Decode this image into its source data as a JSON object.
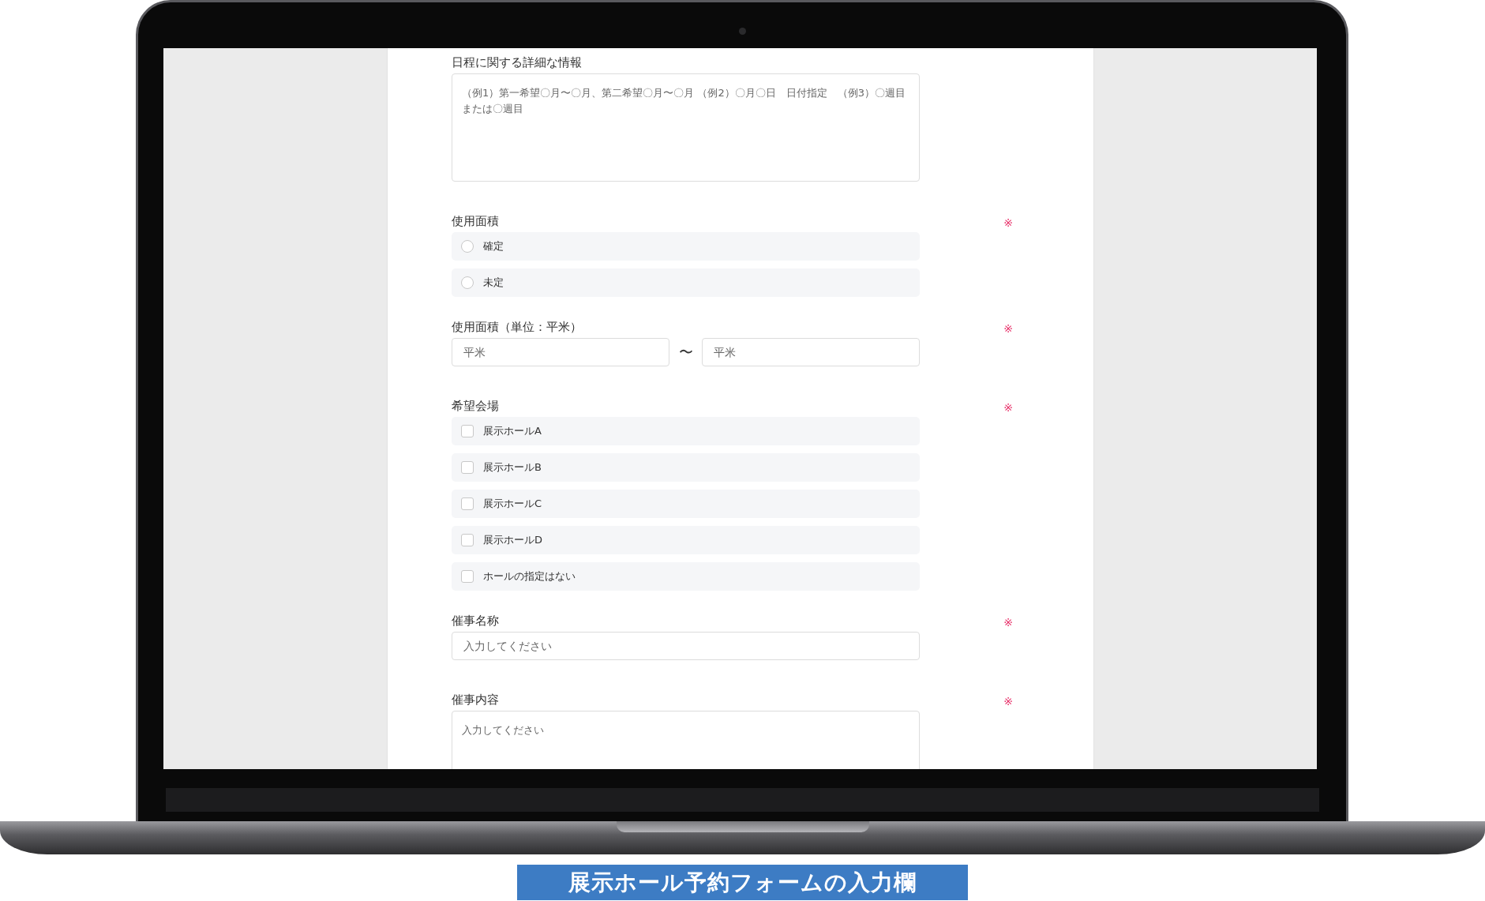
{
  "form": {
    "sections": [
      {
        "kind": "textarea",
        "label": "日程に関する詳細な情報",
        "placeholder": "（例1）第一希望〇月〜〇月、第二希望〇月〜〇月 （例2）〇月〇日　日付指定　（例3）〇週目または〇週目"
      },
      {
        "kind": "radio",
        "label": "使用面積",
        "required_mark": "※",
        "options": [
          {
            "label": "確定",
            "selected": false
          },
          {
            "label": "未定",
            "selected": false
          }
        ]
      },
      {
        "kind": "range",
        "label": "使用面積（単位：平米）",
        "required_mark": "※",
        "from_placeholder": "平米",
        "separator": "〜",
        "to_placeholder": "平米"
      },
      {
        "kind": "checkbox",
        "label": "希望会場",
        "required_mark": "※",
        "options": [
          {
            "label": "展示ホールA",
            "checked": false
          },
          {
            "label": "展示ホールB",
            "checked": false
          },
          {
            "label": "展示ホールC",
            "checked": false
          },
          {
            "label": "展示ホールD",
            "checked": false
          },
          {
            "label": "ホールの指定はない",
            "checked": false
          }
        ]
      },
      {
        "kind": "text",
        "label": "催事名称",
        "required_mark": "※",
        "placeholder": "入力してください"
      },
      {
        "kind": "textarea",
        "label": "催事内容",
        "required_mark": "※",
        "placeholder": "入力してください"
      }
    ]
  },
  "caption": "展示ホール予約フォームの入力欄"
}
